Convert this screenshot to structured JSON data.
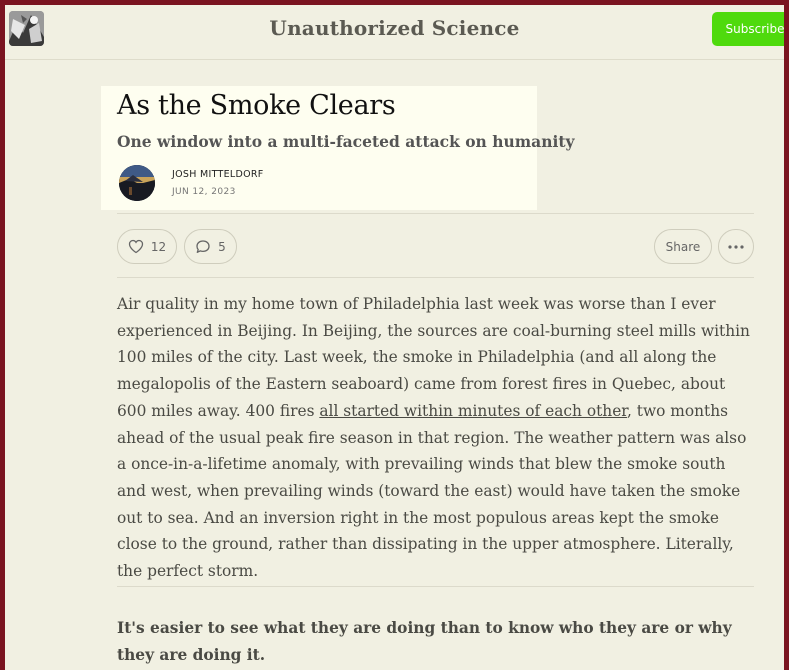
{
  "header": {
    "publication_title": "Unauthorized Science",
    "subscribe_label": "Subscribe",
    "logo_icon": "publication-logo-icon"
  },
  "post": {
    "title": "As the Smoke Clears",
    "subtitle": "One window into a multi-faceted attack on humanity",
    "author": "JOSH MITTELDORF",
    "date": "JUN 12, 2023"
  },
  "actions": {
    "likes": "12",
    "comments": "5",
    "share_label": "Share",
    "like_icon": "heart-icon",
    "comment_icon": "comment-bubble-icon",
    "more_icon": "ellipsis-icon"
  },
  "body": {
    "p1_before_link": "Air quality in my home town of Philadelphia last week was worse than I ever experienced in Beijing. In Beijing, the sources are coal-burning steel mills within 100 miles of the city. Last week, the smoke in Philadelphia (and all along the megalopolis of the Eastern seaboard) came from forest fires in Quebec, about 600 miles away. 400 fires ",
    "p1_link": "all started within minutes of each other",
    "p1_after_link": ", two months ahead of the usual peak fire season in that region. The weather pattern was also a once-in-a-lifetime anomaly, with prevailing winds that blew the smoke south and west, when prevailing winds (toward the east) would have taken the smoke out to sea. And an inversion right in the most populous areas kept the smoke close to the ground, rather than dissipating in the upper atmosphere. Literally, the perfect storm.",
    "p2": "It's easier to see what they are doing than to know who they are or why they are doing it."
  }
}
